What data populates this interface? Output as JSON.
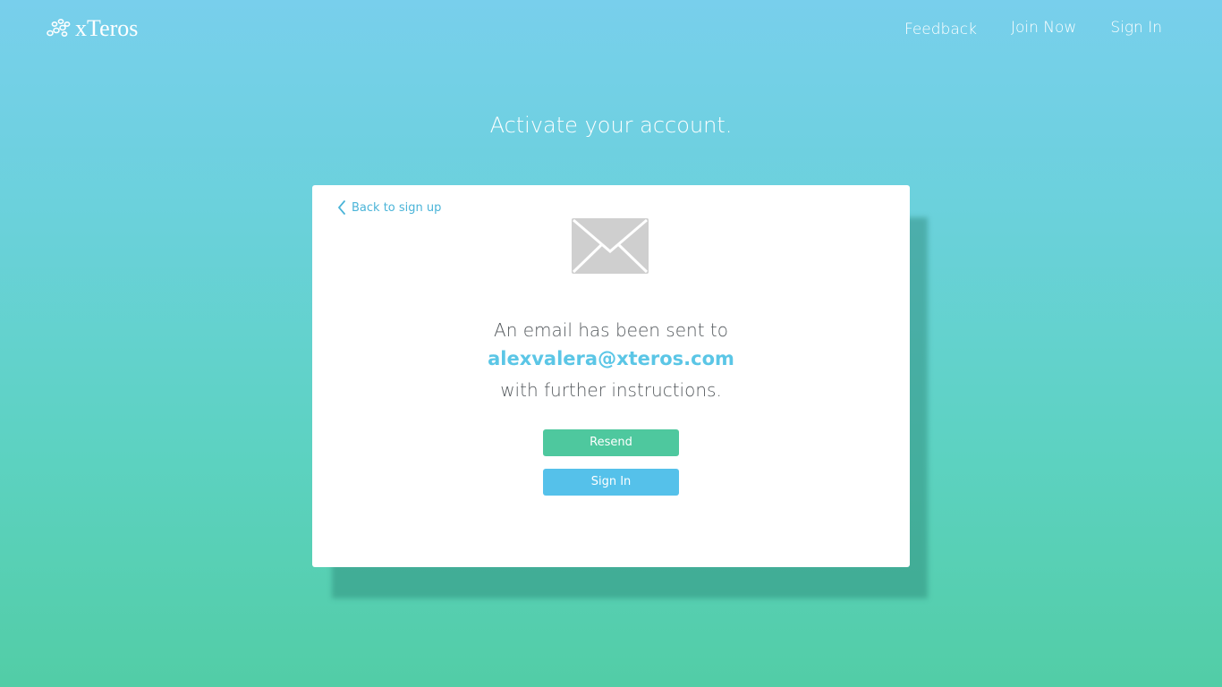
{
  "header": {
    "logo_text": "xTeros",
    "nav": {
      "feedback": "Feedback",
      "join_now": "Join Now",
      "sign_in": "Sign In"
    }
  },
  "page": {
    "title": "Activate your account."
  },
  "card": {
    "back_link": "Back to sign up",
    "message_line1": "An email has been sent to",
    "email": "alexvalera@xteros.com",
    "message_line3": "with further instructions.",
    "resend_label": "Resend",
    "signin_label": "Sign In",
    "icon": "envelope-icon"
  },
  "colors": {
    "bg_top": "#78cfec",
    "bg_bottom": "#52cda6",
    "resend_button": "#4ec89e",
    "signin_button": "#55c1ea",
    "email_accent": "#5bc6e6",
    "link": "#4ab4d8"
  }
}
